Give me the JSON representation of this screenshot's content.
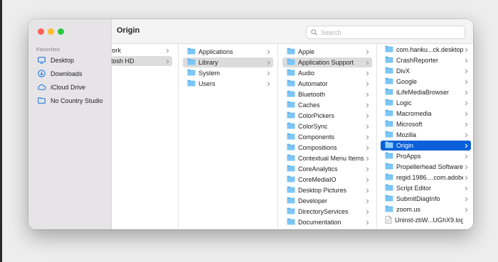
{
  "window": {
    "title": "Origin"
  },
  "search": {
    "placeholder": "Search"
  },
  "sidebar": {
    "heading": "Favorites",
    "items": [
      {
        "label": "Desktop",
        "icon": "desktop-icon"
      },
      {
        "label": "Downloads",
        "icon": "downloads-icon"
      },
      {
        "label": "iCloud Drive",
        "icon": "icloud-icon"
      },
      {
        "label": "No Country Studio",
        "icon": "folder-icon"
      }
    ]
  },
  "columns": [
    {
      "items": [
        {
          "label": "work",
          "arrow": true,
          "state": "none"
        },
        {
          "label": "ntosh HD",
          "arrow": true,
          "state": "parent"
        }
      ]
    },
    {
      "items": [
        {
          "label": "Applications",
          "arrow": true,
          "state": "none"
        },
        {
          "label": "Library",
          "arrow": true,
          "state": "parent"
        },
        {
          "label": "System",
          "arrow": true,
          "state": "none"
        },
        {
          "label": "Users",
          "arrow": true,
          "state": "none"
        }
      ]
    },
    {
      "items": [
        {
          "label": "Apple",
          "arrow": true,
          "state": "none"
        },
        {
          "label": "Application Support",
          "arrow": true,
          "state": "parent"
        },
        {
          "label": "Audio",
          "arrow": true,
          "state": "none"
        },
        {
          "label": "Automator",
          "arrow": true,
          "state": "none"
        },
        {
          "label": "Bluetooth",
          "arrow": true,
          "state": "none"
        },
        {
          "label": "Caches",
          "arrow": true,
          "state": "none"
        },
        {
          "label": "ColorPickers",
          "arrow": true,
          "state": "none"
        },
        {
          "label": "ColorSync",
          "arrow": true,
          "state": "none"
        },
        {
          "label": "Components",
          "arrow": true,
          "state": "none"
        },
        {
          "label": "Compositions",
          "arrow": true,
          "state": "none"
        },
        {
          "label": "Contextual Menu Items",
          "arrow": true,
          "state": "none"
        },
        {
          "label": "CoreAnalytics",
          "arrow": true,
          "state": "none"
        },
        {
          "label": "CoreMediaIO",
          "arrow": true,
          "state": "none"
        },
        {
          "label": "Desktop Pictures",
          "arrow": true,
          "state": "none"
        },
        {
          "label": "Developer",
          "arrow": true,
          "state": "none"
        },
        {
          "label": "DirectoryServices",
          "arrow": true,
          "state": "none"
        },
        {
          "label": "Documentation",
          "arrow": true,
          "state": "none"
        }
      ]
    },
    {
      "items": [
        {
          "label": "com.hanku...ck.desktop",
          "arrow": true,
          "state": "none"
        },
        {
          "label": "CrashReporter",
          "arrow": true,
          "state": "none"
        },
        {
          "label": "DivX",
          "arrow": true,
          "state": "none"
        },
        {
          "label": "Google",
          "arrow": true,
          "state": "none"
        },
        {
          "label": "iLifeMediaBrowser",
          "arrow": true,
          "state": "none"
        },
        {
          "label": "Logic",
          "arrow": true,
          "state": "none"
        },
        {
          "label": "Macromedia",
          "arrow": true,
          "state": "none"
        },
        {
          "label": "Microsoft",
          "arrow": true,
          "state": "none"
        },
        {
          "label": "Mozilla",
          "arrow": true,
          "state": "none"
        },
        {
          "label": "Origin",
          "arrow": true,
          "state": "selected"
        },
        {
          "label": "ProApps",
          "arrow": true,
          "state": "none"
        },
        {
          "label": "Propellerhead Software",
          "arrow": true,
          "state": "none"
        },
        {
          "label": "regid.1986....com.adobe",
          "arrow": true,
          "state": "none"
        },
        {
          "label": "Script Editor",
          "arrow": true,
          "state": "none"
        },
        {
          "label": "SubmitDiagInfo",
          "arrow": true,
          "state": "none"
        },
        {
          "label": "zoom.us",
          "arrow": true,
          "state": "none"
        },
        {
          "label": "Uninst-zbW...UGhX9.log",
          "arrow": false,
          "state": "none",
          "kind": "file"
        }
      ]
    }
  ],
  "colors": {
    "selection_blue": "#0a60d8",
    "selection_gray": "#dcdcdc",
    "folder_blue": "#5bb4ef"
  }
}
